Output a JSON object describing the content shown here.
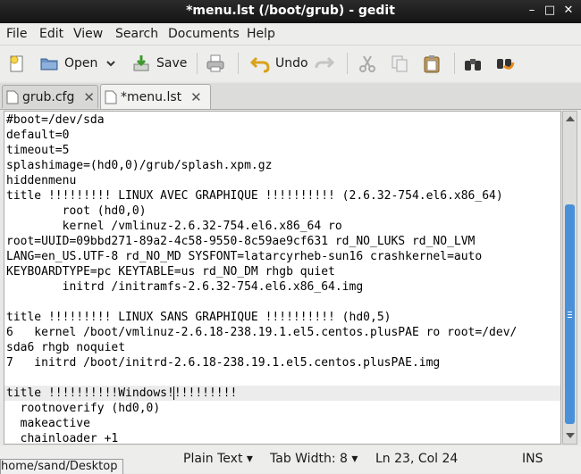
{
  "window": {
    "title": "*menu.lst (/boot/grub) - gedit"
  },
  "menu": [
    "File",
    "Edit",
    "View",
    "Search",
    "Documents",
    "Help"
  ],
  "toolbar": {
    "open_label": "Open",
    "save_label": "Save",
    "undo_label": "Undo"
  },
  "tabs": [
    {
      "label": "grub.cfg"
    },
    {
      "label": "*menu.lst"
    }
  ],
  "editor": {
    "lines": [
      "#boot=/dev/sda",
      "default=0",
      "timeout=5",
      "splashimage=(hd0,0)/grub/splash.xpm.gz",
      "hiddenmenu",
      "title !!!!!!!!! LINUX AVEC GRAPHIQUE !!!!!!!!!! (2.6.32-754.el6.x86_64)",
      "        root (hd0,0)",
      "        kernel /vmlinuz-2.6.32-754.el6.x86_64 ro",
      "root=UUID=09bbd271-89a2-4c58-9550-8c59ae9cf631 rd_NO_LUKS rd_NO_LVM",
      "LANG=en_US.UTF-8 rd_NO_MD SYSFONT=latarcyrheb-sun16 crashkernel=auto",
      "KEYBOARDTYPE=pc KEYTABLE=us rd_NO_DM rhgb quiet",
      "        initrd /initramfs-2.6.32-754.el6.x86_64.img",
      "",
      "title !!!!!!!!! LINUX SANS GRAPHIQUE !!!!!!!!!! (hd0,5)",
      "6   kernel /boot/vmlinuz-2.6.18-238.19.1.el5.centos.plusPAE ro root=/dev/",
      "sda6 rhgb noquiet",
      "7   initrd /boot/initrd-2.6.18-238.19.1.el5.centos.plusPAE.img",
      "",
      "title !!!!!!!!!!Windows!!!!!!!!!!",
      "  rootnoverify (hd0,0)",
      "  makeactive",
      "  chainloader +1"
    ]
  },
  "status": {
    "language": "Plain Text",
    "tab_width": "Tab Width:  8",
    "position": "Ln 23, Col 24",
    "mode": "INS"
  },
  "tooltip": "home/sand/Desktop"
}
